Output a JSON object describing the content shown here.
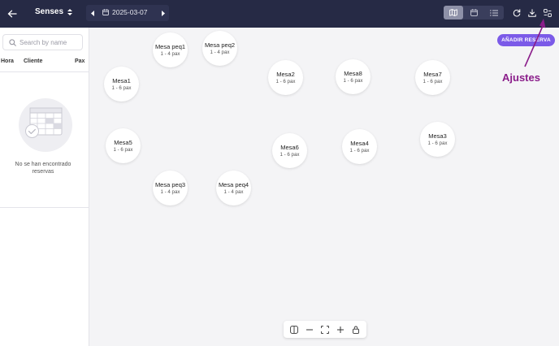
{
  "topbar": {
    "venue_name": "Senses",
    "date": "2025-03-07",
    "icons": [
      "back-arrow-icon",
      "sort-toggle-icon",
      "chevron-left-icon",
      "calendar-icon",
      "chevron-right-icon",
      "map-icon",
      "calendar-view-icon",
      "list-icon",
      "refresh-icon",
      "download-icon",
      "settings-icon"
    ],
    "active_view": "map"
  },
  "sidebar": {
    "search_placeholder": "Search by name",
    "columns": {
      "hora": "Hora",
      "cliente": "Cliente",
      "pax": "Pax"
    },
    "empty_text": "No se han encontrado reservas"
  },
  "canvas": {
    "add_button": "AÑADIR RESERVA",
    "annotation": "Ajustes",
    "tables": [
      {
        "name": "Mesa peq1",
        "pax": "1 - 4 pax"
      },
      {
        "name": "Mesa peq2",
        "pax": "1 - 4 pax"
      },
      {
        "name": "Mesa1",
        "pax": "1 - 6 pax"
      },
      {
        "name": "Mesa2",
        "pax": "1 - 6 pax"
      },
      {
        "name": "Mesa8",
        "pax": "1 - 6 pax"
      },
      {
        "name": "Mesa7",
        "pax": "1 - 6 pax"
      },
      {
        "name": "Mesa5",
        "pax": "1 - 6 pax"
      },
      {
        "name": "Mesa6",
        "pax": "1 - 6 pax"
      },
      {
        "name": "Mesa4",
        "pax": "1 - 6 pax"
      },
      {
        "name": "Mesa3",
        "pax": "1 - 6 pax"
      },
      {
        "name": "Mesa peq3",
        "pax": "1 - 4 pax"
      },
      {
        "name": "Mesa peq4",
        "pax": "1 - 4 pax"
      }
    ]
  },
  "zoom_controls": {
    "icons": [
      "toggle-sidebar-icon",
      "zoom-out-icon",
      "fit-screen-icon",
      "zoom-in-icon",
      "lock-icon"
    ]
  },
  "colors": {
    "topbar": "#262a45",
    "accent": "#7b5ae8",
    "annotation": "#8a1d8a"
  }
}
